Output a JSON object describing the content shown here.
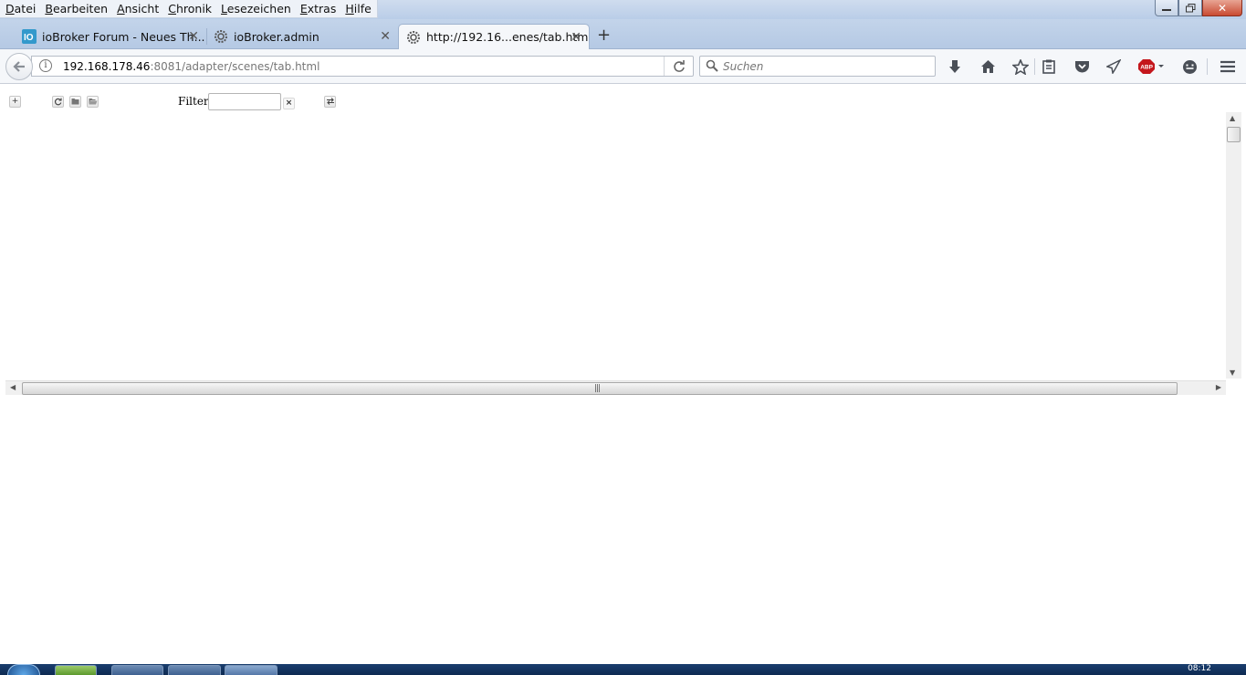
{
  "menubar": {
    "items": [
      {
        "label": "Datei",
        "accel": "D"
      },
      {
        "label": "Bearbeiten",
        "accel": "B"
      },
      {
        "label": "Ansicht",
        "accel": "A"
      },
      {
        "label": "Chronik",
        "accel": "C"
      },
      {
        "label": "Lesezeichen",
        "accel": "L"
      },
      {
        "label": "Extras",
        "accel": "E"
      },
      {
        "label": "Hilfe",
        "accel": "H"
      }
    ]
  },
  "window": {
    "close_glyph": "✕",
    "minimize_glyph": "▁",
    "restore_glyph": "❐"
  },
  "tabs": [
    {
      "label": "ioBroker Forum - Neues Th...",
      "favicon": "iobroker-logo-icon",
      "active": false
    },
    {
      "label": "ioBroker.admin",
      "favicon": "gear-icon",
      "active": false
    },
    {
      "label": "http://192.16...enes/tab.html",
      "favicon": "gear-icon",
      "active": true
    }
  ],
  "new_tab_glyph": "+",
  "tab_close_glyph": "✕",
  "navbar": {
    "url_host": "192.168.178.46",
    "url_rest": ":8081/adapter/scenes/tab.html",
    "search_placeholder": "Suchen",
    "abp_label": "ABP"
  },
  "scenes_toolbar": {
    "add_glyph": "+",
    "filter_label": "Filter:",
    "filter_value": "",
    "clear_glyph": "×"
  },
  "colors": {
    "accent": "#2f6fc0",
    "abp_red": "#c4161c",
    "page_bg": "#ffffff"
  },
  "taskbar": {
    "clock": "08:12"
  }
}
